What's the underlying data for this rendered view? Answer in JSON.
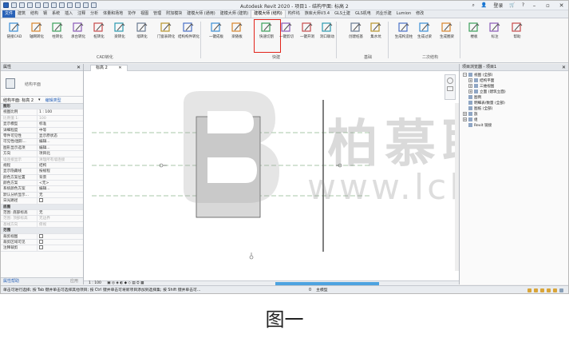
{
  "app": {
    "title": "Autodesk Revit 2020 - 项目1 - 结构平面: 标高 2",
    "signin": "登录",
    "window_controls": [
      "–",
      "▫",
      "✕"
    ]
  },
  "menu_tabs": [
    "文件",
    "建筑",
    "结构",
    "钢",
    "系统",
    "插入",
    "注释",
    "分析",
    "体量和场地",
    "协作",
    "视图",
    "管理",
    "附加模块",
    "建模大师 (通用)",
    "建模大师 (建筑)",
    "建模大师 (结构)",
    "构件坞",
    "族库大师V3.4",
    "GLS土建",
    "GLS机电",
    "鸿业乐建",
    "Lumion",
    "修改"
  ],
  "active_tab_index": 15,
  "ribbon": {
    "buttons": [
      {
        "label": "链接CAD",
        "icon": "link-cad-icon"
      },
      {
        "label": "轴网转化",
        "icon": "grid-convert-icon"
      },
      {
        "label": "柱转化",
        "icon": "column-convert-icon"
      },
      {
        "label": "承台转化",
        "icon": "pilecap-convert-icon"
      },
      {
        "label": "桩转化",
        "icon": "pile-convert-icon"
      },
      {
        "label": "梁转化",
        "icon": "beam-convert-icon"
      },
      {
        "label": "墙转化",
        "icon": "wall-convert-icon"
      },
      {
        "label": "门窗表转化",
        "icon": "door-window-convert-icon"
      },
      {
        "label": "结构构件转化",
        "icon": "structure-convert-icon"
      },
      {
        "label": "一键成板",
        "icon": "slab-icon"
      },
      {
        "label": "梁随板",
        "icon": "beam-follow-slab-icon"
      },
      {
        "label": "快速切割",
        "icon": "quick-cut-icon"
      },
      {
        "label": "一键剪切",
        "icon": "cut-icon"
      },
      {
        "label": "一键开洞",
        "icon": "opening-icon"
      },
      {
        "label": "洞口联动",
        "icon": "opening-link-icon"
      },
      {
        "label": "创建桩基",
        "icon": "create-pile-icon"
      },
      {
        "label": "集水坑",
        "icon": "sump-icon"
      },
      {
        "label": "生成构造柱",
        "icon": "constructional-column-icon"
      },
      {
        "label": "生成过梁",
        "icon": "lintel-icon"
      },
      {
        "label": "生成圈梁",
        "icon": "ring-beam-icon"
      },
      {
        "label": "楼板",
        "icon": "floor-icon"
      },
      {
        "label": "标注",
        "icon": "tag-icon"
      },
      {
        "label": "帮助",
        "icon": "help-icon"
      }
    ],
    "groups": [
      "CAD转化",
      "快建",
      "基础",
      "二次结构"
    ]
  },
  "properties": {
    "header": "属性",
    "type_name": "结构平面",
    "filter_label": "结构平面: 标高 2",
    "edit_type": "编辑类型",
    "rows": [
      {
        "k": "图形",
        "v": "",
        "sect": true
      },
      {
        "k": "视图比例",
        "v": "1 : 100"
      },
      {
        "k": "比例值 1:",
        "v": "100",
        "dim": true
      },
      {
        "k": "显示模型",
        "v": "标准"
      },
      {
        "k": "详细程度",
        "v": "中等"
      },
      {
        "k": "零件可见性",
        "v": "显示原状态"
      },
      {
        "k": "可见性/图形...",
        "v": "编辑..."
      },
      {
        "k": "图形显示选项",
        "v": "编辑..."
      },
      {
        "k": "方向",
        "v": "项目北"
      },
      {
        "k": "墙连接显示",
        "v": "清理所有墙连接",
        "dim": true
      },
      {
        "k": "规程",
        "v": "结构"
      },
      {
        "k": "显示隐藏线",
        "v": "按规程"
      },
      {
        "k": "颜色方案位置",
        "v": "背景"
      },
      {
        "k": "颜色方案",
        "v": "<无>"
      },
      {
        "k": "系统颜色方案",
        "v": "编辑..."
      },
      {
        "k": "默认分析显示...",
        "v": "无"
      },
      {
        "k": "日光路径",
        "v": "",
        "cb": true
      },
      {
        "k": "底图",
        "v": "",
        "sect": true
      },
      {
        "k": "范围: 底部标高",
        "v": "无"
      },
      {
        "k": "范围: 顶部标高",
        "v": "无边界",
        "dim": true
      },
      {
        "k": "基线方向",
        "v": "俯视",
        "dim": true
      },
      {
        "k": "范围",
        "v": "",
        "sect": true
      },
      {
        "k": "裁剪视图",
        "v": "",
        "cb": true
      },
      {
        "k": "裁剪区域可见",
        "v": "",
        "cb": true
      },
      {
        "k": "注释裁剪",
        "v": "",
        "cb": true
      }
    ],
    "help_link": "属性帮助",
    "apply": "应用"
  },
  "view": {
    "tab_label": "标高 2",
    "scale": "1 : 100"
  },
  "watermark": {
    "text": "柏慕联创",
    "url": "www.lcbim.com"
  },
  "browser": {
    "header": "项目浏览器 - 项目1",
    "nodes": [
      {
        "label": "视图 (全部)",
        "indent": 0,
        "toggle": "−"
      },
      {
        "label": "结构平面",
        "indent": 1,
        "toggle": "+"
      },
      {
        "label": "三维视图",
        "indent": 1,
        "toggle": "+"
      },
      {
        "label": "立面 (建筑立面)",
        "indent": 1,
        "toggle": "+"
      },
      {
        "label": "图例",
        "indent": 0,
        "toggle": ""
      },
      {
        "label": "明细表/数量 (全部)",
        "indent": 0,
        "toggle": ""
      },
      {
        "label": "图纸 (全部)",
        "indent": 0,
        "toggle": ""
      },
      {
        "label": "族",
        "indent": 0,
        "toggle": "+"
      },
      {
        "label": "组",
        "indent": 0,
        "toggle": "+"
      },
      {
        "label": "Revit 链接",
        "indent": 0,
        "toggle": ""
      }
    ]
  },
  "status": {
    "hint": "单击可进行选择; 按 Tab 键并单击可选择其他项目; 按 Ctrl 键并单击可将新项目添加到选择集; 按 Shift 键并单击可...",
    "zero": "0",
    "model": "主模型"
  },
  "caption": "图一"
}
